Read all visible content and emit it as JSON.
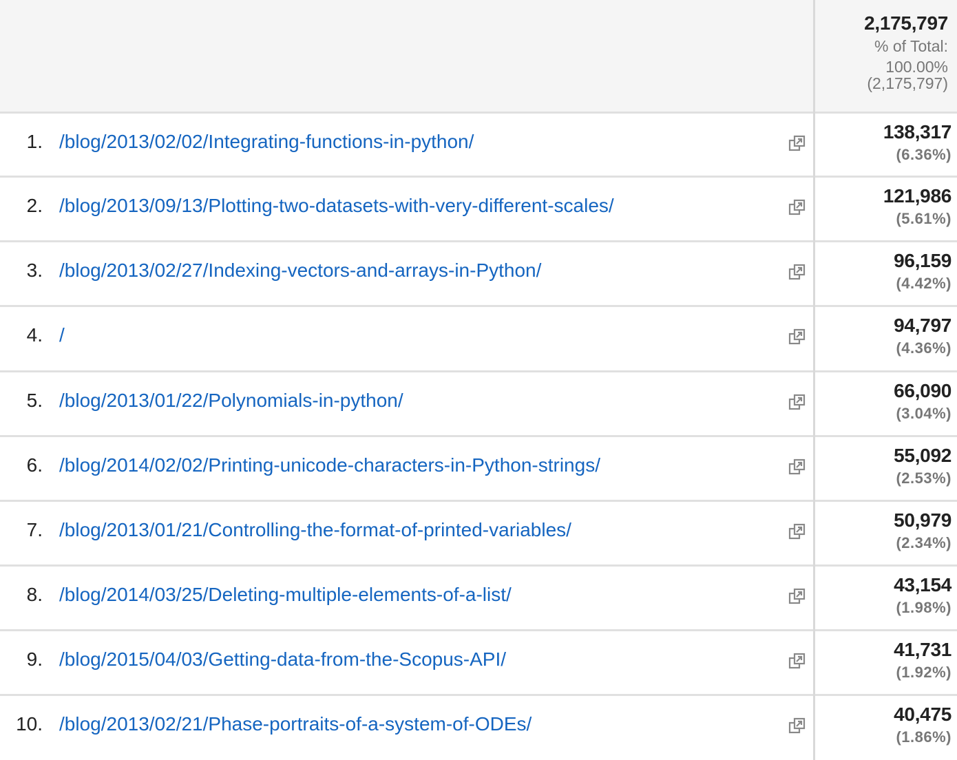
{
  "header": {
    "total_value": "2,175,797",
    "pct_of_total_label": "% of Total:",
    "pct_of_total": "100.00%",
    "total_abs": "(2,175,797)"
  },
  "rows": [
    {
      "index": "1.",
      "page": "/blog/2013/02/02/Integrating-functions-in-python/",
      "value": "138,317",
      "pct": "(6.36%)"
    },
    {
      "index": "2.",
      "page": "/blog/2013/09/13/Plotting-two-datasets-with-very-different-scales/",
      "value": "121,986",
      "pct": "(5.61%)"
    },
    {
      "index": "3.",
      "page": "/blog/2013/02/27/Indexing-vectors-and-arrays-in-Python/",
      "value": "96,159",
      "pct": "(4.42%)"
    },
    {
      "index": "4.",
      "page": "/",
      "value": "94,797",
      "pct": "(4.36%)"
    },
    {
      "index": "5.",
      "page": "/blog/2013/01/22/Polynomials-in-python/",
      "value": "66,090",
      "pct": "(3.04%)"
    },
    {
      "index": "6.",
      "page": "/blog/2014/02/02/Printing-unicode-characters-in-Python-strings/",
      "value": "55,092",
      "pct": "(2.53%)"
    },
    {
      "index": "7.",
      "page": "/blog/2013/01/21/Controlling-the-format-of-printed-variables/",
      "value": "50,979",
      "pct": "(2.34%)"
    },
    {
      "index": "8.",
      "page": "/blog/2014/03/25/Deleting-multiple-elements-of-a-list/",
      "value": "43,154",
      "pct": "(1.98%)"
    },
    {
      "index": "9.",
      "page": "/blog/2015/04/03/Getting-data-from-the-Scopus-API/",
      "value": "41,731",
      "pct": "(1.92%)"
    },
    {
      "index": "10.",
      "page": "/blog/2013/02/21/Phase-portraits-of-a-system-of-ODEs/",
      "value": "40,475",
      "pct": "(1.86%)"
    }
  ],
  "icons": {
    "row_icon": "open-in-new-window-icon"
  },
  "colors": {
    "link": "#1565c0",
    "header_bg": "#f5f5f5",
    "muted_text": "#777777"
  }
}
